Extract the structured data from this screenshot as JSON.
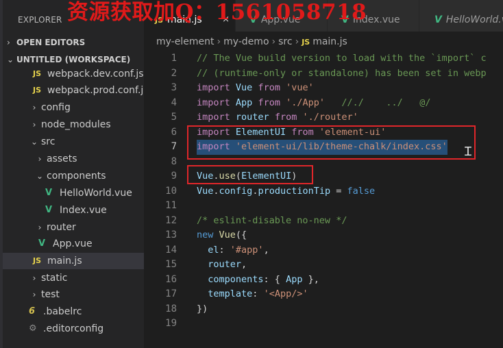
{
  "watermark": "资源获取加Q：1561058718",
  "sidebar": {
    "title": "EXPLORER",
    "open_editors": "OPEN EDITORS",
    "workspace": "UNTITLED (WORKSPACE)",
    "items": [
      {
        "label": "webpack.dev.conf.js",
        "icon": "js",
        "icon_text": "JS"
      },
      {
        "label": "webpack.prod.conf.js",
        "icon": "js",
        "icon_text": "JS"
      },
      {
        "label": "config",
        "chevron": "›"
      },
      {
        "label": "node_modules",
        "chevron": "›"
      },
      {
        "label": "src",
        "chevron": "⌄"
      },
      {
        "label": "assets",
        "chevron": "›"
      },
      {
        "label": "components",
        "chevron": "⌄"
      },
      {
        "label": "HelloWorld.vue",
        "icon": "vue",
        "icon_text": "V"
      },
      {
        "label": "Index.vue",
        "icon": "vue",
        "icon_text": "V"
      },
      {
        "label": "router",
        "chevron": "›"
      },
      {
        "label": "App.vue",
        "icon": "vue",
        "icon_text": "V"
      },
      {
        "label": "main.js",
        "icon": "js",
        "icon_text": "JS",
        "selected": true
      },
      {
        "label": "static",
        "chevron": "›"
      },
      {
        "label": "test",
        "chevron": "›"
      },
      {
        "label": ".babelrc",
        "icon": "babel",
        "icon_text": "6"
      },
      {
        "label": ".editorconfig",
        "icon": "gear",
        "icon_text": "⚙"
      }
    ]
  },
  "tabs": [
    {
      "label": "main.js",
      "icon": "js",
      "icon_text": "JS",
      "active": true,
      "close": "×"
    },
    {
      "label": "App.vue",
      "icon": "vue",
      "icon_text": "V"
    },
    {
      "label": "Index.vue",
      "icon": "vue",
      "icon_text": "V"
    },
    {
      "label": "HelloWorld.vue",
      "icon": "vue",
      "icon_text": "V"
    }
  ],
  "breadcrumb": {
    "parts": [
      "my-element",
      "my-demo",
      "src"
    ],
    "file": "main.js",
    "file_icon": "JS",
    "separator": "›"
  },
  "code": {
    "current_line": 7,
    "lines": [
      {
        "n": "1",
        "tokens": [
          [
            "cm",
            "// The Vue build version to load with the `import` c"
          ]
        ]
      },
      {
        "n": "2",
        "tokens": [
          [
            "cm",
            "// (runtime-only or standalone) has been set in webp"
          ]
        ]
      },
      {
        "n": "3",
        "tokens": [
          [
            "kw",
            "import"
          ],
          [
            "pl",
            " "
          ],
          [
            "id",
            "Vue"
          ],
          [
            "pl",
            " "
          ],
          [
            "kw",
            "from"
          ],
          [
            "pl",
            " "
          ],
          [
            "str",
            "'vue'"
          ]
        ]
      },
      {
        "n": "4",
        "tokens": [
          [
            "kw",
            "import"
          ],
          [
            "pl",
            " "
          ],
          [
            "id",
            "App"
          ],
          [
            "pl",
            " "
          ],
          [
            "kw",
            "from"
          ],
          [
            "pl",
            " "
          ],
          [
            "str",
            "'./App'"
          ],
          [
            "pl",
            "   "
          ],
          [
            "cm",
            "//./    ../   @/"
          ]
        ]
      },
      {
        "n": "5",
        "tokens": [
          [
            "kw",
            "import"
          ],
          [
            "pl",
            " "
          ],
          [
            "id",
            "router"
          ],
          [
            "pl",
            " "
          ],
          [
            "kw",
            "from"
          ],
          [
            "pl",
            " "
          ],
          [
            "str",
            "'./router'"
          ]
        ]
      },
      {
        "n": "6",
        "tokens": [
          [
            "kw",
            "import"
          ],
          [
            "pl",
            " "
          ],
          [
            "id",
            "ElementUI"
          ],
          [
            "pl",
            " "
          ],
          [
            "kw",
            "from"
          ],
          [
            "pl",
            " "
          ],
          [
            "str",
            "'element-ui'"
          ]
        ]
      },
      {
        "n": "7",
        "tokens": [
          [
            "kw",
            "import"
          ],
          [
            "pl",
            " "
          ],
          [
            "str",
            "'element-ui/lib/theme-chalk/index.css'"
          ]
        ],
        "selected": true
      },
      {
        "n": "8",
        "tokens": []
      },
      {
        "n": "9",
        "tokens": [
          [
            "id",
            "Vue"
          ],
          [
            "pl",
            "."
          ],
          [
            "fn",
            "use"
          ],
          [
            "pl",
            "("
          ],
          [
            "id",
            "ElementUI"
          ],
          [
            "pl",
            ")"
          ]
        ]
      },
      {
        "n": "10",
        "tokens": [
          [
            "id",
            "Vue"
          ],
          [
            "pl",
            "."
          ],
          [
            "id",
            "config"
          ],
          [
            "pl",
            "."
          ],
          [
            "id",
            "productionTip"
          ],
          [
            "pl",
            " = "
          ],
          [
            "bool",
            "false"
          ]
        ]
      },
      {
        "n": "11",
        "tokens": []
      },
      {
        "n": "12",
        "tokens": [
          [
            "cm",
            "/* eslint-disable no-new */"
          ]
        ]
      },
      {
        "n": "13",
        "tokens": [
          [
            "bool",
            "new"
          ],
          [
            "pl",
            " "
          ],
          [
            "fn",
            "Vue"
          ],
          [
            "pl",
            "({"
          ]
        ]
      },
      {
        "n": "14",
        "tokens": [
          [
            "pl",
            "  "
          ],
          [
            "id",
            "el"
          ],
          [
            "pl",
            ": "
          ],
          [
            "str",
            "'#app'"
          ],
          [
            "pl",
            ","
          ]
        ]
      },
      {
        "n": "15",
        "tokens": [
          [
            "pl",
            "  "
          ],
          [
            "id",
            "router"
          ],
          [
            "pl",
            ","
          ]
        ]
      },
      {
        "n": "16",
        "tokens": [
          [
            "pl",
            "  "
          ],
          [
            "id",
            "components"
          ],
          [
            "pl",
            ": { "
          ],
          [
            "id",
            "App"
          ],
          [
            "pl",
            " },"
          ]
        ]
      },
      {
        "n": "17",
        "tokens": [
          [
            "pl",
            "  "
          ],
          [
            "id",
            "template"
          ],
          [
            "pl",
            ": "
          ],
          [
            "str",
            "'<App/>'"
          ]
        ]
      },
      {
        "n": "18",
        "tokens": [
          [
            "pl",
            "})"
          ]
        ]
      },
      {
        "n": "19",
        "tokens": []
      }
    ]
  },
  "colors": {
    "annotation_box": "#e0262a",
    "selection": "#264f78",
    "watermark": "#e01a1a"
  }
}
